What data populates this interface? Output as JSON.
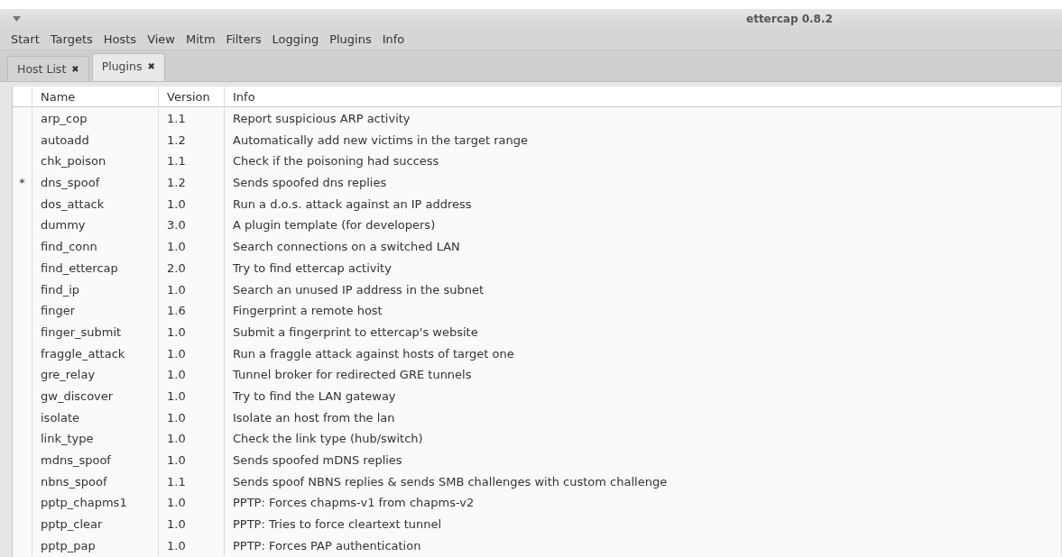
{
  "window": {
    "title": "ettercap 0.8.2"
  },
  "menu": [
    "Start",
    "Targets",
    "Hosts",
    "View",
    "Mitm",
    "Filters",
    "Logging",
    "Plugins",
    "Info"
  ],
  "tabs": [
    {
      "label": "Host List",
      "close": "✖",
      "selected": false
    },
    {
      "label": "Plugins",
      "close": "✖",
      "selected": true
    }
  ],
  "table": {
    "columns": [
      "Name",
      "Version",
      "Info"
    ],
    "rows": [
      {
        "name": "arp_cop",
        "version": "1.1",
        "info": "Report suspicious ARP activity"
      },
      {
        "name": "autoadd",
        "version": "1.2",
        "info": "Automatically add new victims in the target range"
      },
      {
        "name": "chk_poison",
        "version": "1.1",
        "info": "Check if the poisoning had success"
      },
      {
        "marker": "*",
        "name": "dns_spoof",
        "version": "1.2",
        "info": "Sends spoofed dns replies"
      },
      {
        "name": "dos_attack",
        "version": "1.0",
        "info": "Run a d.o.s. attack against an IP address"
      },
      {
        "name": "dummy",
        "version": "3.0",
        "info": "A plugin template (for developers)"
      },
      {
        "name": "find_conn",
        "version": "1.0",
        "info": "Search connections on a switched LAN"
      },
      {
        "name": "find_ettercap",
        "version": "2.0",
        "info": "Try to find ettercap activity"
      },
      {
        "name": "find_ip",
        "version": "1.0",
        "info": "Search an unused IP address in the subnet"
      },
      {
        "name": "finger",
        "version": "1.6",
        "info": "Fingerprint a remote host"
      },
      {
        "name": "finger_submit",
        "version": "1.0",
        "info": "Submit a fingerprint to ettercap's website"
      },
      {
        "name": "fraggle_attack",
        "version": "1.0",
        "info": "Run a fraggle attack against hosts of target one"
      },
      {
        "name": "gre_relay",
        "version": "1.0",
        "info": "Tunnel broker for redirected GRE tunnels"
      },
      {
        "name": "gw_discover",
        "version": "1.0",
        "info": "Try to find the LAN gateway"
      },
      {
        "name": "isolate",
        "version": "1.0",
        "info": "Isolate an host from the lan"
      },
      {
        "name": "link_type",
        "version": "1.0",
        "info": "Check the link type (hub/switch)"
      },
      {
        "name": "mdns_spoof",
        "version": "1.0",
        "info": "Sends spoofed mDNS replies"
      },
      {
        "name": "nbns_spoof",
        "version": "1.1",
        "info": "Sends spoof NBNS replies & sends SMB challenges with custom challenge"
      },
      {
        "name": "pptp_chapms1",
        "version": "1.0",
        "info": "PPTP: Forces chapms-v1 from chapms-v2"
      },
      {
        "name": "pptp_clear",
        "version": "1.0",
        "info": "PPTP: Tries to force cleartext tunnel"
      },
      {
        "name": "pptp_pap",
        "version": "1.0",
        "info": "PPTP: Forces PAP authentication"
      }
    ]
  }
}
